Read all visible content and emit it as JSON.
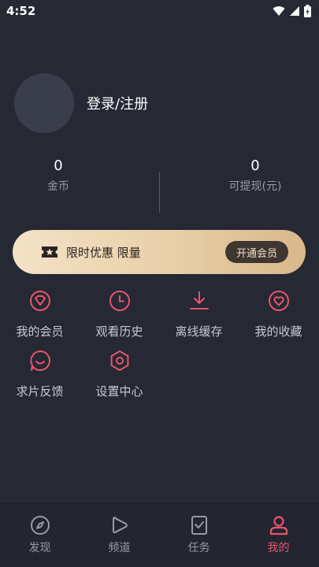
{
  "status_bar": {
    "time": "4:52",
    "icons": [
      "wifi-icon",
      "signal-icon",
      "battery-icon"
    ]
  },
  "profile": {
    "login_label": "登录/注册"
  },
  "stats": {
    "coins": {
      "value": "0",
      "label": "金币"
    },
    "withdrawable": {
      "value": "0",
      "label": "可提现(元)"
    }
  },
  "vip_banner": {
    "text": "限时优惠 限量",
    "button_label": "开通会员",
    "icon": "ticket-star-icon"
  },
  "menu": [
    {
      "label": "我的会员",
      "icon": "diamond-icon"
    },
    {
      "label": "观看历史",
      "icon": "clock-icon"
    },
    {
      "label": "离线缓存",
      "icon": "download-icon"
    },
    {
      "label": "我的收藏",
      "icon": "heart-icon"
    },
    {
      "label": "求片反馈",
      "icon": "chat-bubble-icon"
    },
    {
      "label": "设置中心",
      "icon": "settings-hexagon-icon"
    }
  ],
  "bottom_nav": [
    {
      "label": "发现",
      "icon": "compass-icon",
      "active": false
    },
    {
      "label": "频道",
      "icon": "play-icon",
      "active": false
    },
    {
      "label": "任务",
      "icon": "task-check-icon",
      "active": false
    },
    {
      "label": "我的",
      "icon": "user-icon",
      "active": true
    }
  ],
  "colors": {
    "background": "#262834",
    "accent": "#e6566a",
    "banner_gold": "#e8cfa8",
    "banner_button": "#3f3531"
  }
}
